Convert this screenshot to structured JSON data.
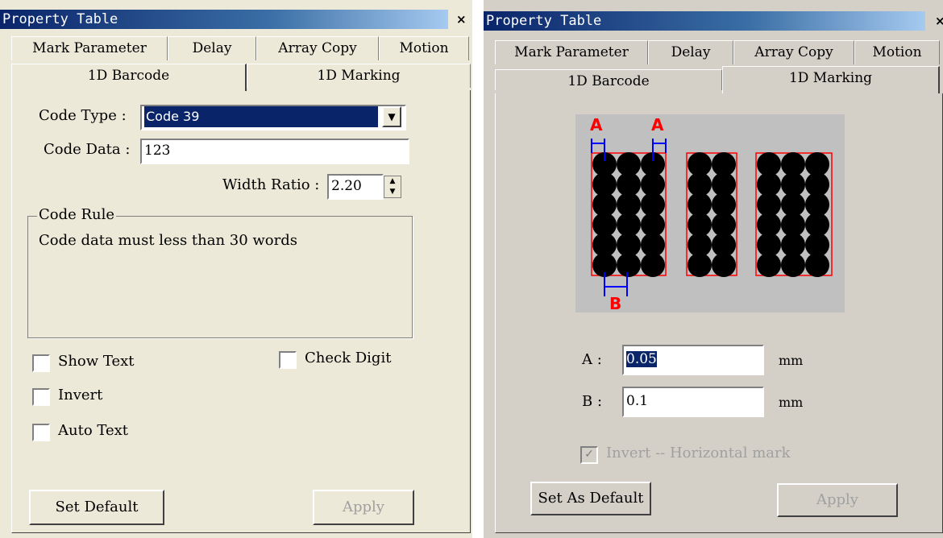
{
  "left": {
    "title": "Property Table",
    "close": "×",
    "tabs_row1": [
      "Mark Parameter",
      "Delay",
      "Array Copy",
      "Motion"
    ],
    "tabs_row2": [
      "1D Barcode",
      "1D Marking"
    ],
    "active_tab": "1D Barcode",
    "code_type_label": "Code Type :",
    "code_type_value": "Code 39",
    "code_data_label": "Code Data :",
    "code_data_value": "123",
    "width_ratio_label": "Width Ratio :",
    "width_ratio_value": "2.20",
    "code_rule_title": "Code Rule",
    "code_rule_text": "Code data must less than 30 words",
    "checkboxes": {
      "show_text": "Show Text",
      "check_digit": "Check Digit",
      "invert": "Invert",
      "auto_text": "Auto Text"
    },
    "set_default": "Set Default",
    "apply": "Apply"
  },
  "right": {
    "title": "Property Table",
    "close": "×",
    "tabs_row1": [
      "Mark Parameter",
      "Delay",
      "Array Copy",
      "Motion"
    ],
    "tabs_row2": [
      "1D Barcode",
      "1D Marking"
    ],
    "active_tab": "1D Marking",
    "diagram_labels": {
      "a": "A",
      "b": "B"
    },
    "a_label": "A :",
    "a_value": "0.05",
    "b_label": "B :",
    "b_value": "0.1",
    "unit": "mm",
    "invert_label": "Invert -- Horizontal mark",
    "invert_checked": true,
    "set_as_default": "Set As Default",
    "apply": "Apply"
  }
}
